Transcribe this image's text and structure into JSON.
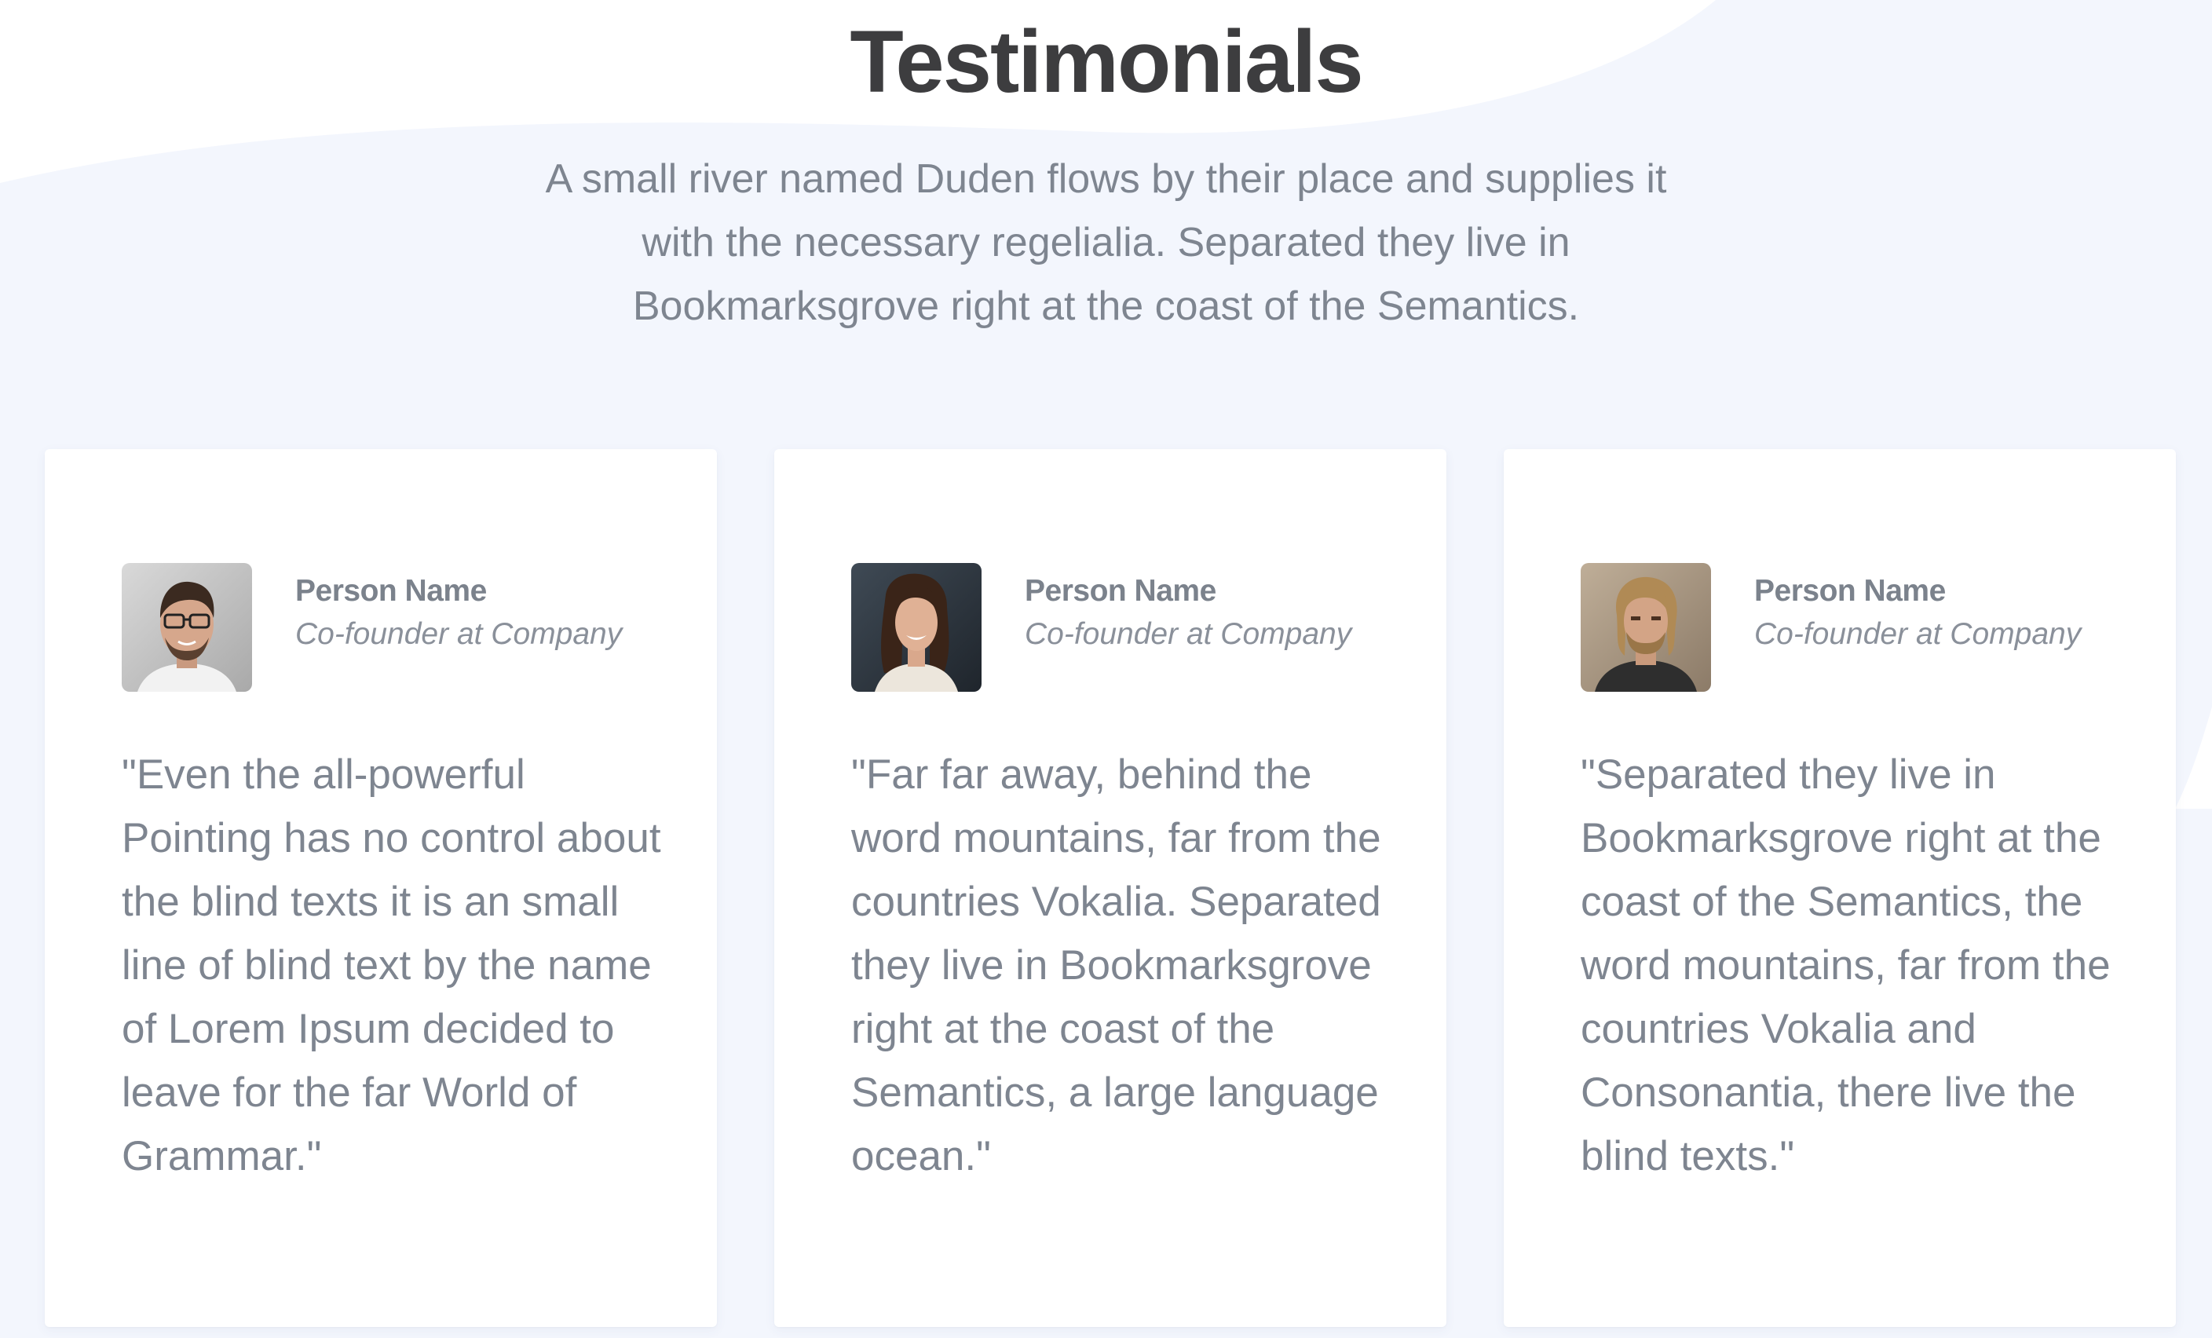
{
  "section": {
    "title": "Testimonials",
    "subtitle": "A small river named Duden flows by their place and supplies it with the necessary regelialia. Separated they live in Bookmarksgrove right at the coast of the Semantics."
  },
  "colors": {
    "background_tint": "#f3f6fd",
    "title": "#3d3d3f",
    "body_text": "#7e8590",
    "card": "#ffffff"
  },
  "testimonials": [
    {
      "name": "Person Name",
      "role": "Co-founder at Company",
      "quote": "\"Even the all-powerful Pointing has no control about the blind texts it is an small line of blind text by the name of Lorem Ipsum decided to leave for the far World of Grammar.\"",
      "avatar": "man-with-glasses-photo"
    },
    {
      "name": "Person Name",
      "role": "Co-founder at Company",
      "quote": "\"Far far away, behind the word mountains, far from the countries Vokalia. Separated they live in Bookmarksgrove right at the coast of the Semantics, a large language ocean.\"",
      "avatar": "smiling-woman-photo"
    },
    {
      "name": "Person Name",
      "role": "Co-founder at Company",
      "quote": "\"Separated they live in Bookmarksgrove right at the coast of the Semantics, the word mountains, far from the countries Vokalia and Consonantia, there live the blind texts.\"",
      "avatar": "bearded-man-photo"
    }
  ]
}
